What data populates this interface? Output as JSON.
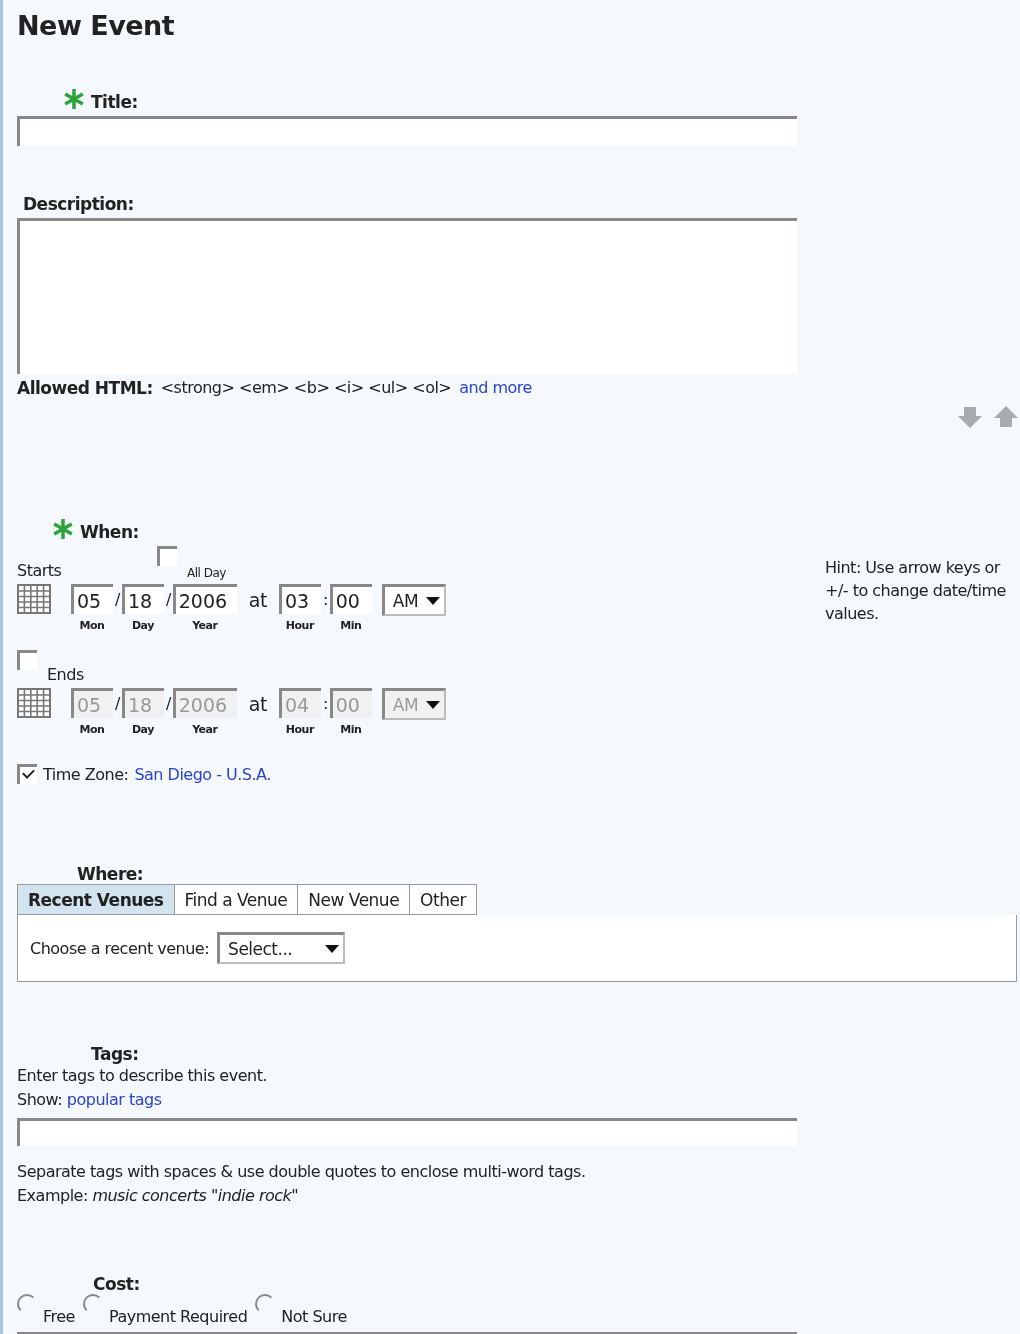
{
  "heading": "New Event",
  "title_field": {
    "label": "Title:",
    "required": true
  },
  "description_field": {
    "label": "Description:"
  },
  "allowed_html": {
    "label": "Allowed HTML:",
    "tags": "<strong> <em> <b> <i> <ul> <ol>",
    "link": "and more"
  },
  "when": {
    "label": "When:",
    "required": true,
    "starts": {
      "label": "Starts",
      "all_day": {
        "label": "All Day",
        "checked": false
      },
      "enabled": true,
      "date": [
        {
          "value": "05",
          "caption": "Mon"
        },
        {
          "value": "18",
          "caption": "Day"
        },
        {
          "value": "2006",
          "caption": "Year"
        }
      ],
      "date_separator": "/",
      "time_separator": ":",
      "separator": "at",
      "time": [
        {
          "value": "03",
          "caption": "Hour"
        },
        {
          "value": "00",
          "caption": "Min"
        }
      ],
      "ampm": "AM"
    },
    "ends": {
      "label": "Ends",
      "checked": false,
      "enabled": false,
      "date": [
        {
          "value": "05",
          "caption": "Mon"
        },
        {
          "value": "18",
          "caption": "Day"
        },
        {
          "value": "2006",
          "caption": "Year"
        }
      ],
      "date_separator": "/",
      "time_separator": ":",
      "separator": "at",
      "time": [
        {
          "value": "04",
          "caption": "Hour"
        },
        {
          "value": "00",
          "caption": "Min"
        }
      ],
      "ampm": "AM"
    },
    "time_zone": {
      "checked": true,
      "label": "Time Zone:",
      "link": "San Diego - U.S.A."
    },
    "hint": "Hint: Use arrow keys or +/- to change date/time values."
  },
  "where": {
    "label": "Where:",
    "tabs": [
      {
        "label": "Recent Venues",
        "selected": true
      },
      {
        "label": "Find a Venue",
        "selected": false
      },
      {
        "label": "New Venue",
        "selected": false
      },
      {
        "label": "Other",
        "selected": false
      }
    ],
    "prompt": "Choose a recent venue:",
    "select": "Select..."
  },
  "tags": {
    "label": "Tags:",
    "intro": "Enter tags to describe this event.",
    "show_label": "Show:",
    "show_link": "popular tags",
    "note": "Separate tags with spaces & use double quotes to enclose multi-word tags.",
    "example": "Example: *music concerts \"indie rock\"*"
  },
  "cost": {
    "label": "Cost:",
    "options": [
      {
        "label": "Free",
        "selected": false
      },
      {
        "label": "Payment Required",
        "selected": false
      },
      {
        "label": "Not Sure",
        "selected": false
      }
    ]
  }
}
